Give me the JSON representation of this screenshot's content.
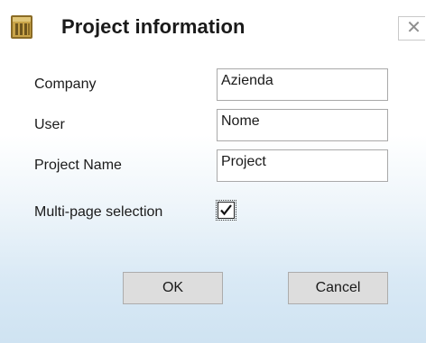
{
  "window": {
    "title": "Project information",
    "app_icon": "project-folder-icon",
    "close_glyph": "✕"
  },
  "form": {
    "company_label": "Company",
    "company_value": "Azienda",
    "user_label": "User",
    "user_value": "Nome",
    "project_name_label": "Project Name",
    "project_name_value": "Project",
    "multipage_label": "Multi-page selection",
    "multipage_checked": true
  },
  "buttons": {
    "ok_label": "OK",
    "cancel_label": "Cancel"
  },
  "colors": {
    "bottom_gradient": "#cfe3f2",
    "button_face": "#dddddd",
    "icon_gold": "#b8953a"
  }
}
